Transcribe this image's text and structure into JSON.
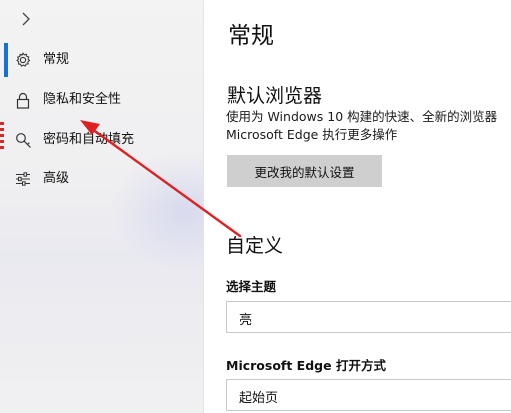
{
  "sidebar": {
    "items": [
      {
        "label": "常规",
        "icon": "gear-icon",
        "selected": true
      },
      {
        "label": "隐私和安全性",
        "icon": "lock-icon",
        "selected": false
      },
      {
        "label": "密码和自动填充",
        "icon": "key-icon",
        "selected": false
      },
      {
        "label": "高级",
        "icon": "sliders-icon",
        "selected": false
      }
    ],
    "accent_color": "#1570d8"
  },
  "main": {
    "title": "常规",
    "default_browser": {
      "heading": "默认浏览器",
      "description_line1": "使用为 Windows 10 构建的快速、全新的浏览器",
      "description_line2": "Microsoft Edge 执行更多操作",
      "button_label": "更改我的默认设置"
    },
    "customize": {
      "heading": "自定义",
      "theme_label": "选择主题",
      "theme_value": "亮",
      "open_with_label": "Microsoft Edge 打开方式",
      "open_with_value": "起始页"
    }
  },
  "annotation": {
    "color": "#e02020"
  }
}
